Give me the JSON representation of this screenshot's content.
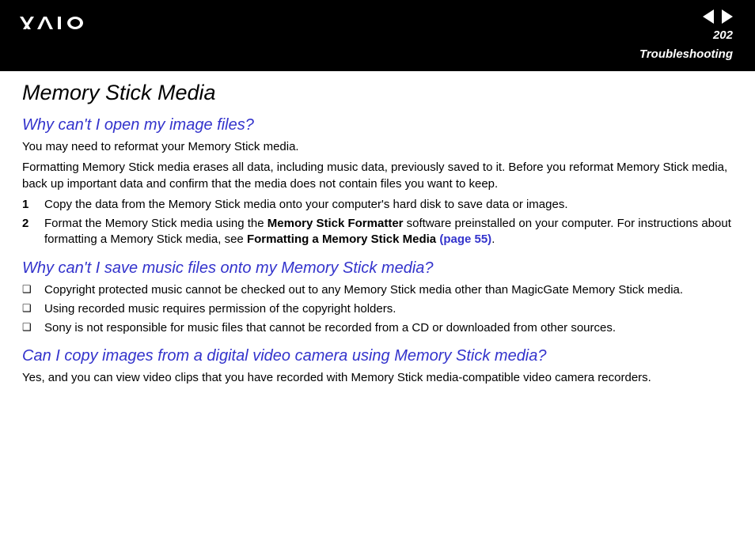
{
  "header": {
    "page_number": "202",
    "section": "Troubleshooting"
  },
  "title": "Memory Stick Media",
  "q1": {
    "heading": "Why can't I open my image files?",
    "p1": "You may need to reformat your Memory Stick media.",
    "p2": "Formatting Memory Stick media erases all data, including music data, previously saved to it. Before you reformat Memory Stick media, back up important data and confirm that the media does not contain files you want to keep.",
    "steps": [
      {
        "n": "1",
        "text": "Copy the data from the Memory Stick media onto your computer's hard disk to save data or images."
      },
      {
        "n": "2",
        "pre": "Format the Memory Stick media using the ",
        "b1": "Memory Stick Formatter",
        "mid": " software preinstalled on your computer. For instructions about formatting a Memory Stick media, see ",
        "b2": "Formatting a Memory Stick Media",
        "link": " (page 55)",
        "post": "."
      }
    ]
  },
  "q2": {
    "heading": "Why can't I save music files onto my Memory Stick media?",
    "bullets": [
      "Copyright protected music cannot be checked out to any Memory Stick media other than MagicGate Memory Stick media.",
      "Using recorded music requires permission of the copyright holders.",
      "Sony is not responsible for music files that cannot be recorded from a CD or downloaded from other sources."
    ]
  },
  "q3": {
    "heading": "Can I copy images from a digital video camera using Memory Stick media?",
    "p1": "Yes, and you can view video clips that you have recorded with Memory Stick media-compatible video camera recorders."
  }
}
